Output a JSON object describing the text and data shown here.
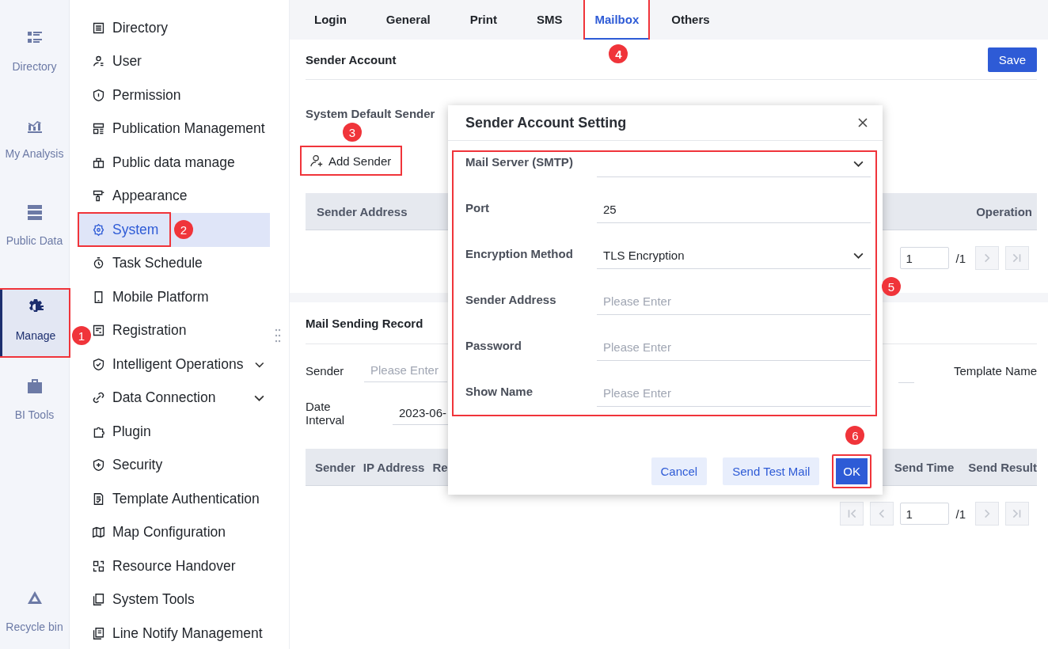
{
  "rail": [
    {
      "label": "Directory",
      "selected": false,
      "outlined": false
    },
    {
      "label": "My Analysis",
      "selected": false,
      "outlined": false
    },
    {
      "label": "Public Data",
      "selected": false,
      "outlined": false
    },
    {
      "label": "Manage",
      "selected": true,
      "outlined": true,
      "callout": "1"
    },
    {
      "label": "BI Tools",
      "selected": false,
      "outlined": false
    },
    {
      "label": "Recycle bin",
      "selected": false,
      "outlined": false
    }
  ],
  "menu": [
    {
      "label": "Directory",
      "selected": false
    },
    {
      "label": "User",
      "selected": false
    },
    {
      "label": "Permission",
      "selected": false
    },
    {
      "label": "Publication Management",
      "selected": false
    },
    {
      "label": "Public data manage",
      "selected": false
    },
    {
      "label": "Appearance",
      "selected": false
    },
    {
      "label": "System",
      "selected": true,
      "outlined": true,
      "callout": "2"
    },
    {
      "label": "Task Schedule",
      "selected": false
    },
    {
      "label": "Mobile Platform",
      "selected": false
    },
    {
      "label": "Registration",
      "selected": false
    },
    {
      "label": "Intelligent Operations",
      "selected": false,
      "expanded": false
    },
    {
      "label": "Data Connection",
      "selected": false,
      "expanded": false
    },
    {
      "label": "Plugin",
      "selected": false
    },
    {
      "label": "Security",
      "selected": false
    },
    {
      "label": "Template Authentication",
      "selected": false
    },
    {
      "label": "Map Configuration",
      "selected": false
    },
    {
      "label": "Resource Handover",
      "selected": false
    },
    {
      "label": "System Tools",
      "selected": false
    },
    {
      "label": "Line Notify Management",
      "selected": false
    }
  ],
  "tabs": [
    {
      "label": "Login",
      "selected": false,
      "outlined": false
    },
    {
      "label": "General",
      "selected": false,
      "outlined": false
    },
    {
      "label": "Print",
      "selected": false,
      "outlined": false
    },
    {
      "label": "SMS",
      "selected": false,
      "outlined": false
    },
    {
      "label": "Mailbox",
      "selected": true,
      "outlined": true,
      "callout": "4"
    },
    {
      "label": "Others",
      "selected": false,
      "outlined": false
    }
  ],
  "sender_account": {
    "title": "Sender Account",
    "save_button": "Save",
    "default_sender_label": "System Default Sender",
    "add_button": {
      "label": "Add Sender",
      "outlined": true,
      "callout": "3"
    },
    "table": {
      "columns": [
        "Sender Address",
        "Operation"
      ]
    },
    "pagination": {
      "page": "1",
      "total": "/1"
    }
  },
  "record": {
    "title": "Mail Sending Record",
    "filters": {
      "sender_label": "Sender",
      "sender_placeholder": "Please Enter",
      "template_label": "Template Name",
      "date_label": "Date Interval",
      "date_value": "2023-06-"
    },
    "table": {
      "columns_left": [
        "Sender",
        "IP Address",
        "Re"
      ],
      "columns_right": [
        "Send Time",
        "Send Result"
      ]
    },
    "pagination": {
      "page": "1",
      "total": "/1"
    }
  },
  "dialog": {
    "title": "Sender Account Setting",
    "form_outlined": true,
    "form_callout": "5",
    "fields": [
      {
        "kind": "select",
        "label": "Mail Server (SMTP)"
      },
      {
        "kind": "text",
        "label": "Port",
        "value": "25"
      },
      {
        "kind": "select",
        "label": "Encryption Method",
        "value": "TLS Encryption"
      },
      {
        "kind": "text",
        "label": "Sender Address",
        "placeholder": "Please Enter"
      },
      {
        "kind": "text",
        "label": "Password",
        "placeholder": "Please Enter"
      },
      {
        "kind": "text",
        "label": "Show Name",
        "placeholder": "Please Enter"
      }
    ],
    "buttons": [
      {
        "kind": "secondary",
        "label": "Cancel",
        "outlined": false
      },
      {
        "kind": "secondary",
        "label": "Send Test Mail",
        "outlined": false
      },
      {
        "kind": "primary",
        "label": "OK",
        "outlined": true,
        "callout": "6"
      }
    ]
  }
}
